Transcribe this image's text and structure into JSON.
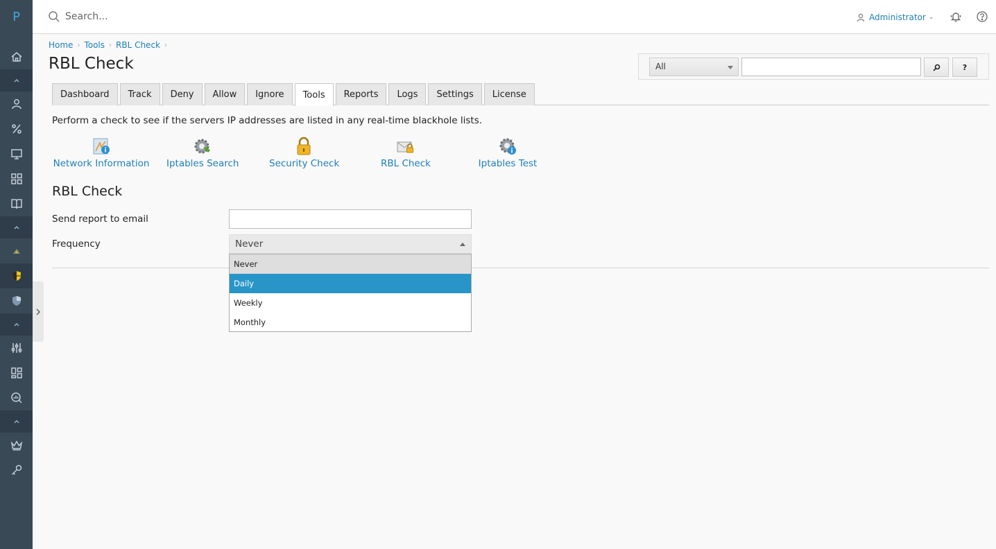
{
  "nav": {
    "logo": "P"
  },
  "topbar": {
    "search_placeholder": "Search...",
    "user": "Administrator"
  },
  "breadcrumb": {
    "items": [
      "Home",
      "Tools",
      "RBL Check"
    ]
  },
  "page": {
    "title": "RBL Check"
  },
  "filter": {
    "selected": "All",
    "search_button_icon": "⌕",
    "help_button": "?"
  },
  "tabs": [
    "Dashboard",
    "Track",
    "Deny",
    "Allow",
    "Ignore",
    "Tools",
    "Reports",
    "Logs",
    "Settings",
    "License"
  ],
  "active_tab": "Tools",
  "intro_text": "Perform a check to see if the servers IP addresses are listed in any real-time blackhole lists.",
  "tools": [
    {
      "label": "Network Information",
      "icon": "network-info-icon"
    },
    {
      "label": "Iptables Search",
      "icon": "gear-search-icon"
    },
    {
      "label": "Security Check",
      "icon": "padlock-icon"
    },
    {
      "label": "RBL Check",
      "icon": "mail-lock-icon"
    },
    {
      "label": "Iptables Test",
      "icon": "gear-info-icon"
    }
  ],
  "form": {
    "section_title": "RBL Check",
    "email_label": "Send report to email",
    "email_value": "",
    "frequency_label": "Frequency",
    "frequency_value": "Never",
    "frequency_options": [
      "Never",
      "Daily",
      "Weekly",
      "Monthly"
    ],
    "highlighted_option": "Daily"
  },
  "colors": {
    "nav_bg": "#3a4956",
    "link": "#1e7fb8",
    "highlight": "#2795c8"
  }
}
